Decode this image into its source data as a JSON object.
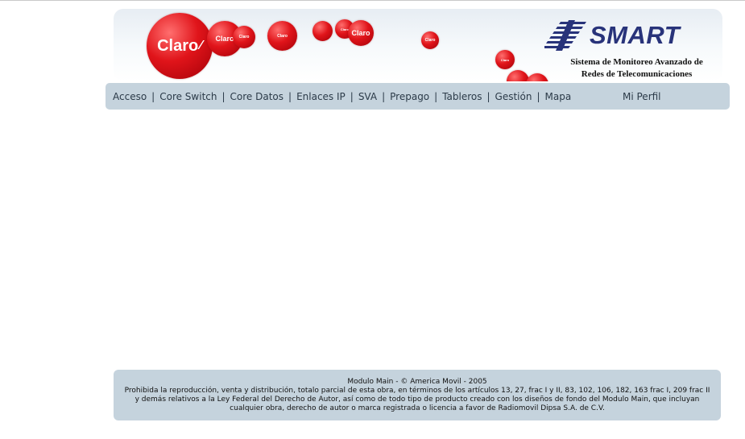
{
  "header": {
    "claro_logo_text": "Claro",
    "bubble_texts": [
      "Claro",
      "Claro",
      "Claro",
      "Claro",
      "Claro",
      "Claro",
      "Claro"
    ],
    "smart_logo_text": "SMART",
    "subtitle_line1": "Sistema de Monitoreo Avanzado de",
    "subtitle_line2": "Redes de Telecomunicaciones",
    "colors": {
      "claro_red": "#e0141a",
      "smart_blue": "#28337a"
    }
  },
  "nav": {
    "items": [
      {
        "label": "Acceso"
      },
      {
        "label": "Core Switch"
      },
      {
        "label": "Core Datos"
      },
      {
        "label": "Enlaces IP"
      },
      {
        "label": "SVA"
      },
      {
        "label": "Prepago"
      },
      {
        "label": "Tableros"
      },
      {
        "label": "Gestión"
      },
      {
        "label": "Mapa"
      }
    ],
    "separator": "|",
    "profile_label": "Mi Perfil",
    "bar_color": "#c5d3dd"
  },
  "footer": {
    "title": "Modulo Main - © America Movil - 2005",
    "legal": "Prohibida la reproducción, venta y distribución, totalo parcial de esta obra, en términos de los artículos 13, 27, frac I y II, 83, 102, 106, 182, 163 frac I, 209 frac II y demás relativos a la Ley Federal del Derecho de Autor, así como de todo tipo de producto creado con los diseños de fondo del Modulo Main, que incluyan cualquier obra, derecho de autor o marca registrada o licencia a favor de Radiomovil Dipsa S.A. de C.V."
  }
}
